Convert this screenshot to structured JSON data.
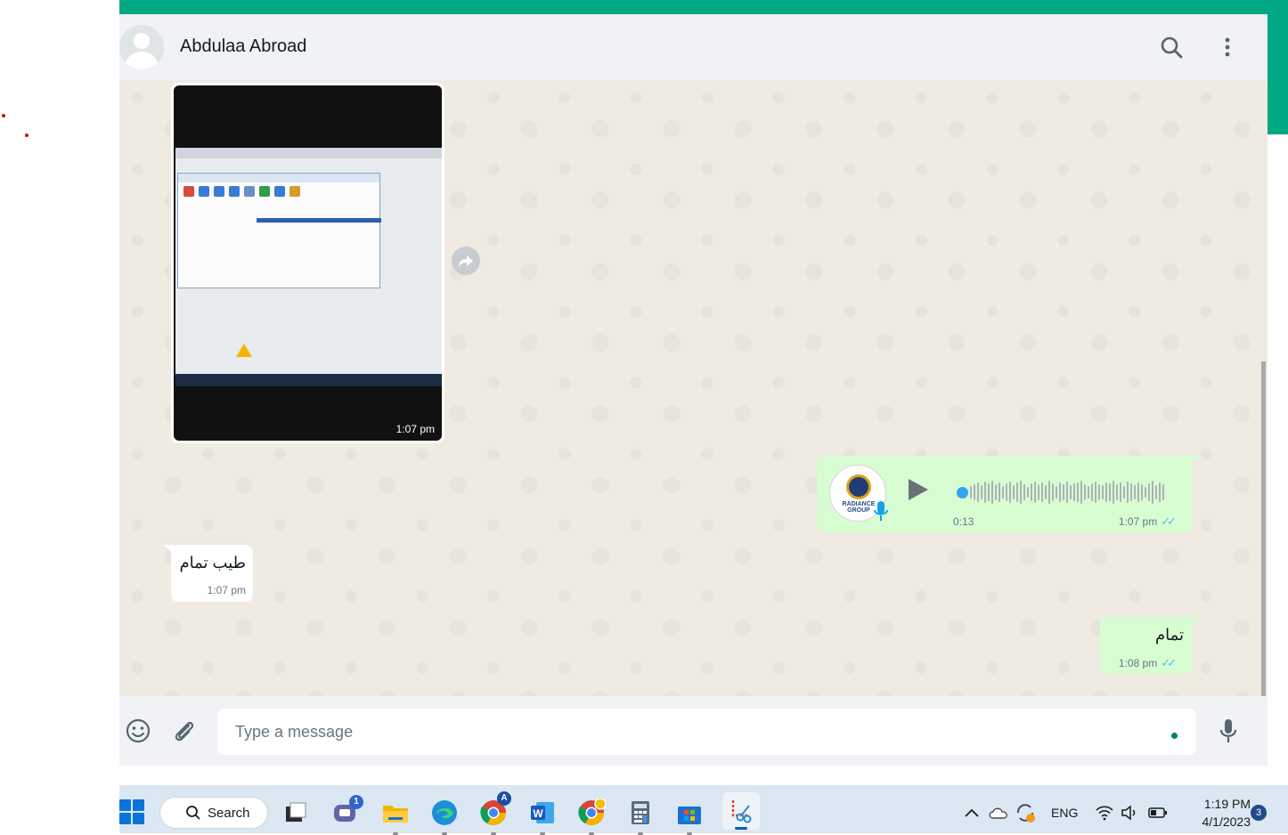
{
  "chat": {
    "contact_name": "Abdulaa Abroad",
    "messages": [
      {
        "type": "image",
        "direction": "incoming",
        "time": "1:07 pm"
      },
      {
        "type": "voice",
        "direction": "outgoing",
        "duration": "0:13",
        "time": "1:07 pm",
        "status": "read",
        "avatar_text": "RADIANCE GROUP"
      },
      {
        "type": "text",
        "direction": "incoming",
        "text": "طيب تمام",
        "time": "1:07 pm"
      },
      {
        "type": "text",
        "direction": "outgoing",
        "text": "تمام",
        "time": "1:08 pm",
        "status": "read"
      }
    ]
  },
  "composer": {
    "placeholder": "Type a message"
  },
  "icons": {
    "header": [
      "search-icon",
      "menu-icon"
    ],
    "composer": [
      "emoji-icon",
      "attach-icon",
      "microphone-icon"
    ]
  },
  "taskbar": {
    "search_label": "Search",
    "apps": [
      "file-manager",
      "teams-chat",
      "file-explorer",
      "edge",
      "chrome",
      "word",
      "chrome-profile",
      "calculator",
      "microsoft-store",
      "snipping-tool"
    ],
    "chat_badge": "1",
    "chrome_badge": "A",
    "language": "ENG",
    "time": "1:19 PM",
    "date": "4/1/2023",
    "notifications": "3"
  },
  "colors": {
    "accent": "#00a884",
    "outgoing_bubble": "#d9fdd3",
    "chat_background": "#efeae2",
    "read_ticks": "#53bdeb"
  }
}
